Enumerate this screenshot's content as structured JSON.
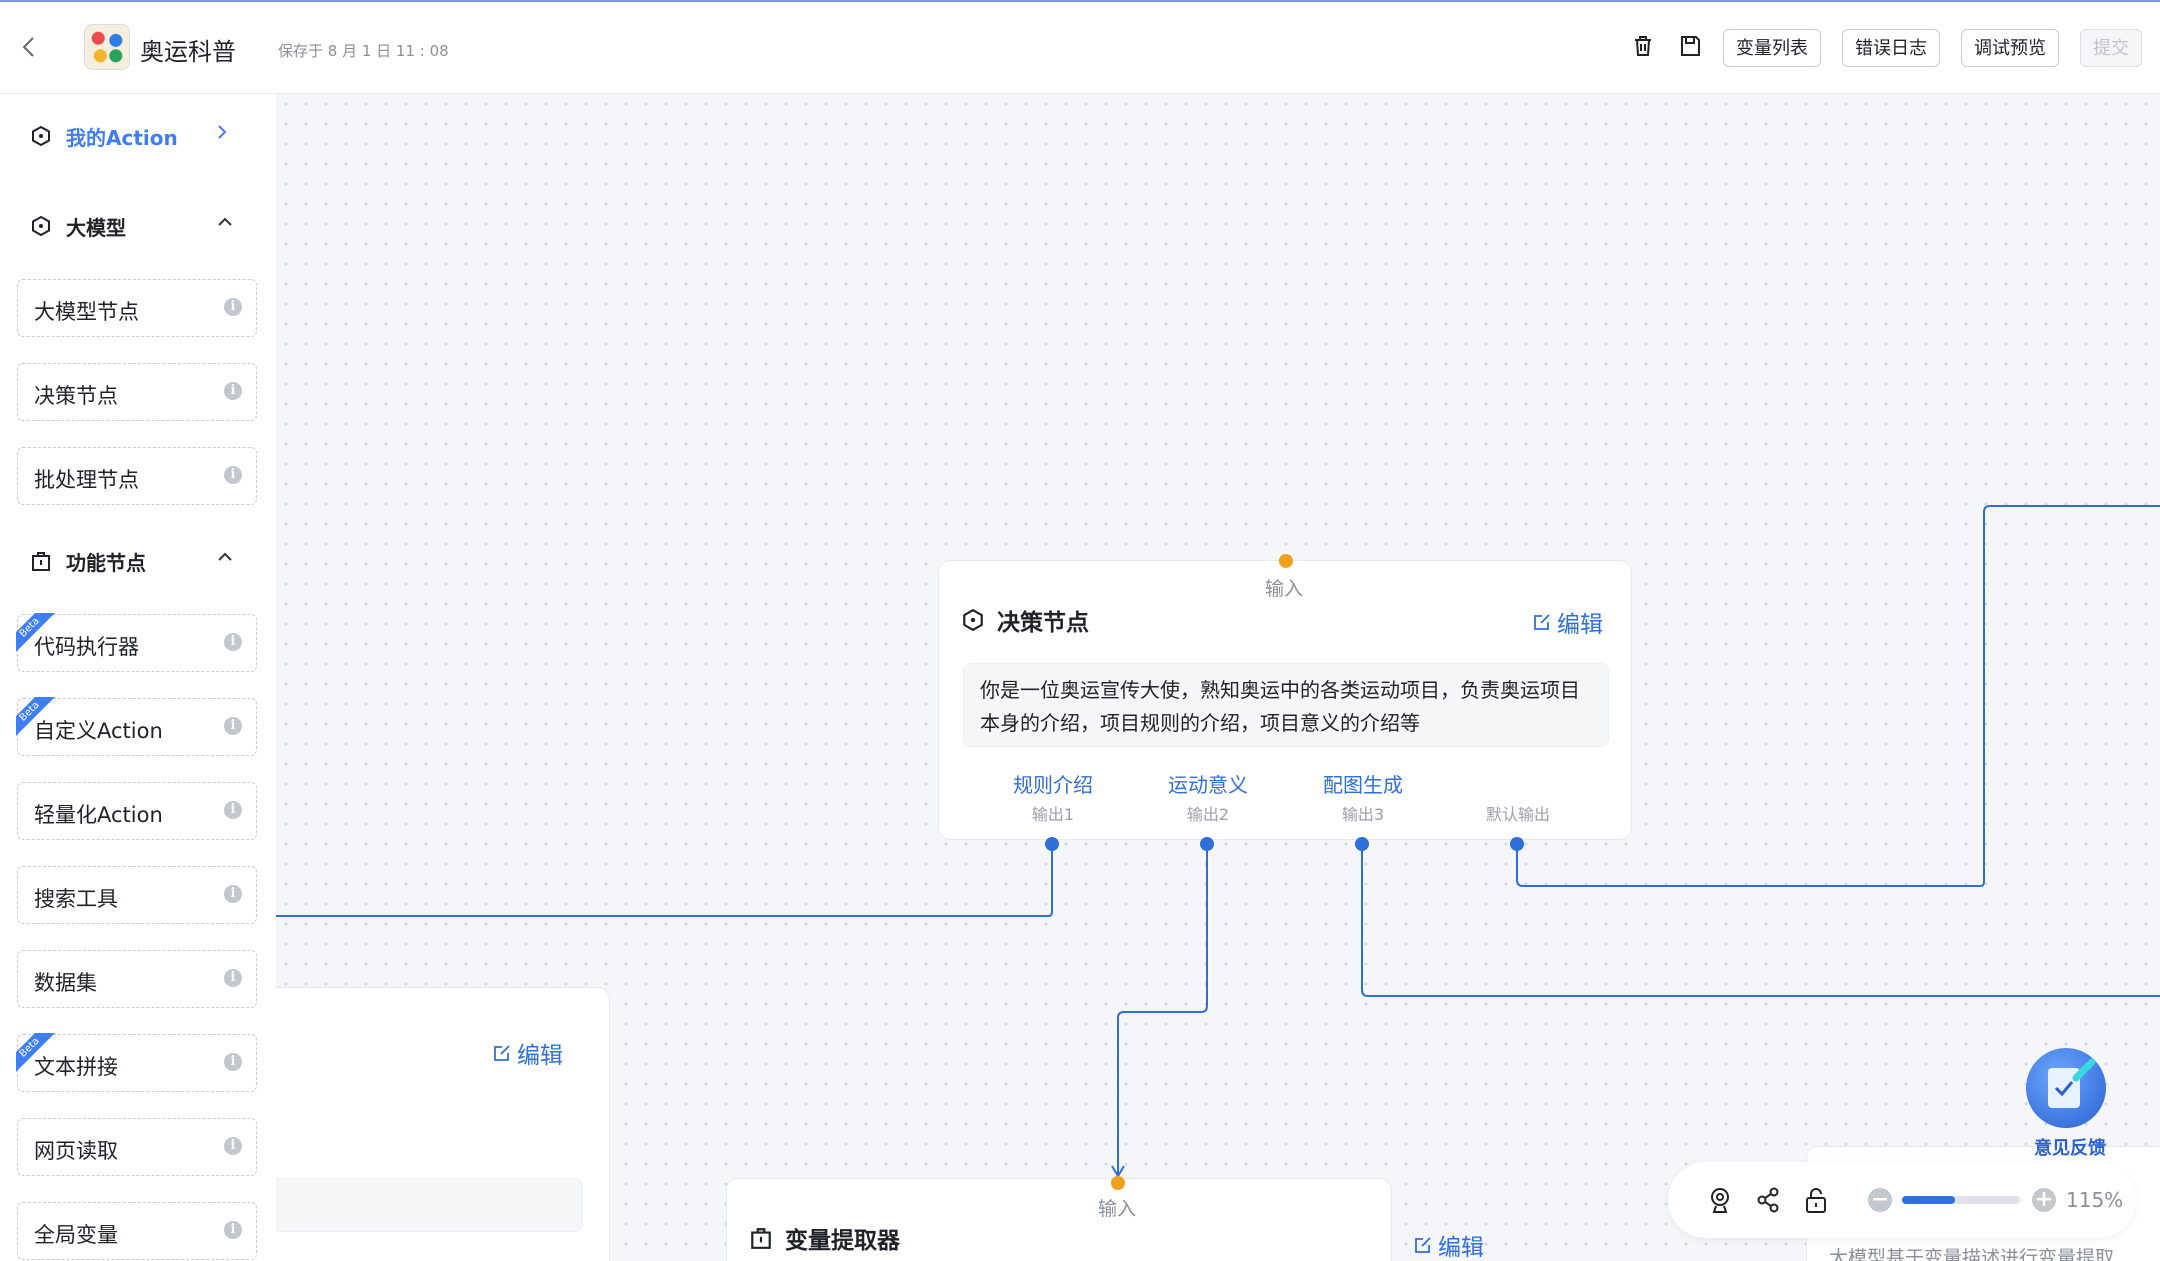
{
  "header": {
    "back_icon": "chevron-left-icon",
    "app_title": "奥运科普",
    "save_time": "保存于 8 月 1 日 11 : 08",
    "buttons": {
      "variables": "变量列表",
      "error_log": "错误日志",
      "debug_preview": "调试预览",
      "submit": "提交"
    },
    "icons": [
      "trash-icon",
      "save-icon"
    ]
  },
  "sidebar": {
    "my_action": "我的Action",
    "llm_section": "大模型",
    "llm_items": [
      "大模型节点",
      "决策节点",
      "批处理节点"
    ],
    "func_section": "功能节点",
    "func_items": [
      "代码执行器",
      "自定义Action",
      "轻量化Action",
      "搜索工具",
      "数据集",
      "文本拼接",
      "网页读取",
      "全局变量"
    ],
    "beta_label": "Beta",
    "beta_items": [
      "代码执行器",
      "自定义Action",
      "文本拼接"
    ]
  },
  "canvas": {
    "decision_node": {
      "input_label": "输入",
      "title": "决策节点",
      "edit": "编辑",
      "prompt": "你是一位奥运宣传大使，熟知奥运中的各类运动项目，负责奥运项目本身的介绍，项目规则的介绍，项目意义的介绍等",
      "outputs": [
        {
          "name": "规则介绍",
          "sub": "输出1"
        },
        {
          "name": "运动意义",
          "sub": "输出2"
        },
        {
          "name": "配图生成",
          "sub": "输出3"
        },
        {
          "name": "",
          "sub": "默认输出"
        }
      ]
    },
    "left_node": {
      "edit": "编辑"
    },
    "extractor_node": {
      "input_label": "输入",
      "title": "变量提取器",
      "edit": "编辑"
    },
    "right_node_text": "大模型基于变量描述进行变量提取"
  },
  "zoom": {
    "percent": "115%",
    "level": 0.45,
    "icons": [
      "location-icon",
      "share-icon",
      "unlock-icon",
      "zoom-out-icon",
      "zoom-in-icon"
    ]
  },
  "feedback": {
    "label": "意见反馈"
  },
  "colors": {
    "accent": "#2e6fdc",
    "input_port": "#f0a020",
    "edge": "#2e6fdc"
  }
}
